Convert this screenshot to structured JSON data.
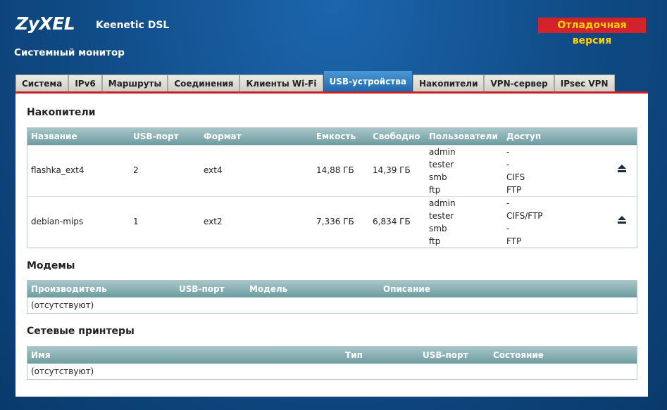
{
  "header": {
    "logo": "ZyXEL",
    "model": "Keenetic DSL",
    "debug_badge": "Отладочная версия",
    "page_title": "Системный монитор"
  },
  "tabs": [
    {
      "label": "Система"
    },
    {
      "label": "IPv6"
    },
    {
      "label": "Маршруты"
    },
    {
      "label": "Соединения"
    },
    {
      "label": "Клиенты Wi-Fi"
    },
    {
      "label": "USB-устройства",
      "active": true
    },
    {
      "label": "Накопители"
    },
    {
      "label": "VPN-сервер"
    },
    {
      "label": "IPsec VPN"
    }
  ],
  "storage": {
    "title": "Накопители",
    "columns": [
      "Название",
      "USB-порт",
      "Формат",
      "Емкость",
      "Свободно",
      "Пользователи",
      "Доступ"
    ],
    "rows": [
      {
        "name": "flashka_ext4",
        "port": "2",
        "format": "ext4",
        "capacity": "14,88 ГБ",
        "free": "14,39 ГБ",
        "users": [
          "admin",
          "tester",
          "smb",
          "ftp"
        ],
        "access": [
          "-",
          "-",
          "CIFS",
          "FTP"
        ]
      },
      {
        "name": "debian-mips",
        "port": "1",
        "format": "ext2",
        "capacity": "7,336 ГБ",
        "free": "6,834 ГБ",
        "users": [
          "admin",
          "tester",
          "smb",
          "ftp"
        ],
        "access": [
          "-",
          "CIFS/FTP",
          "-",
          "FTP"
        ]
      }
    ]
  },
  "modems": {
    "title": "Модемы",
    "columns": [
      "Производитель",
      "USB-порт",
      "Модель",
      "Описание"
    ],
    "empty": "(отсутствуют)"
  },
  "printers": {
    "title": "Сетевые принтеры",
    "columns": [
      "Имя",
      "Тип",
      "USB-порт",
      "Состояние"
    ],
    "empty": "(отсутствуют)"
  },
  "colors": {
    "accent": "#2f7fc1",
    "debug_bg": "#d2232a",
    "debug_fg": "#ffd200",
    "table_header": "#7fa9ad"
  }
}
